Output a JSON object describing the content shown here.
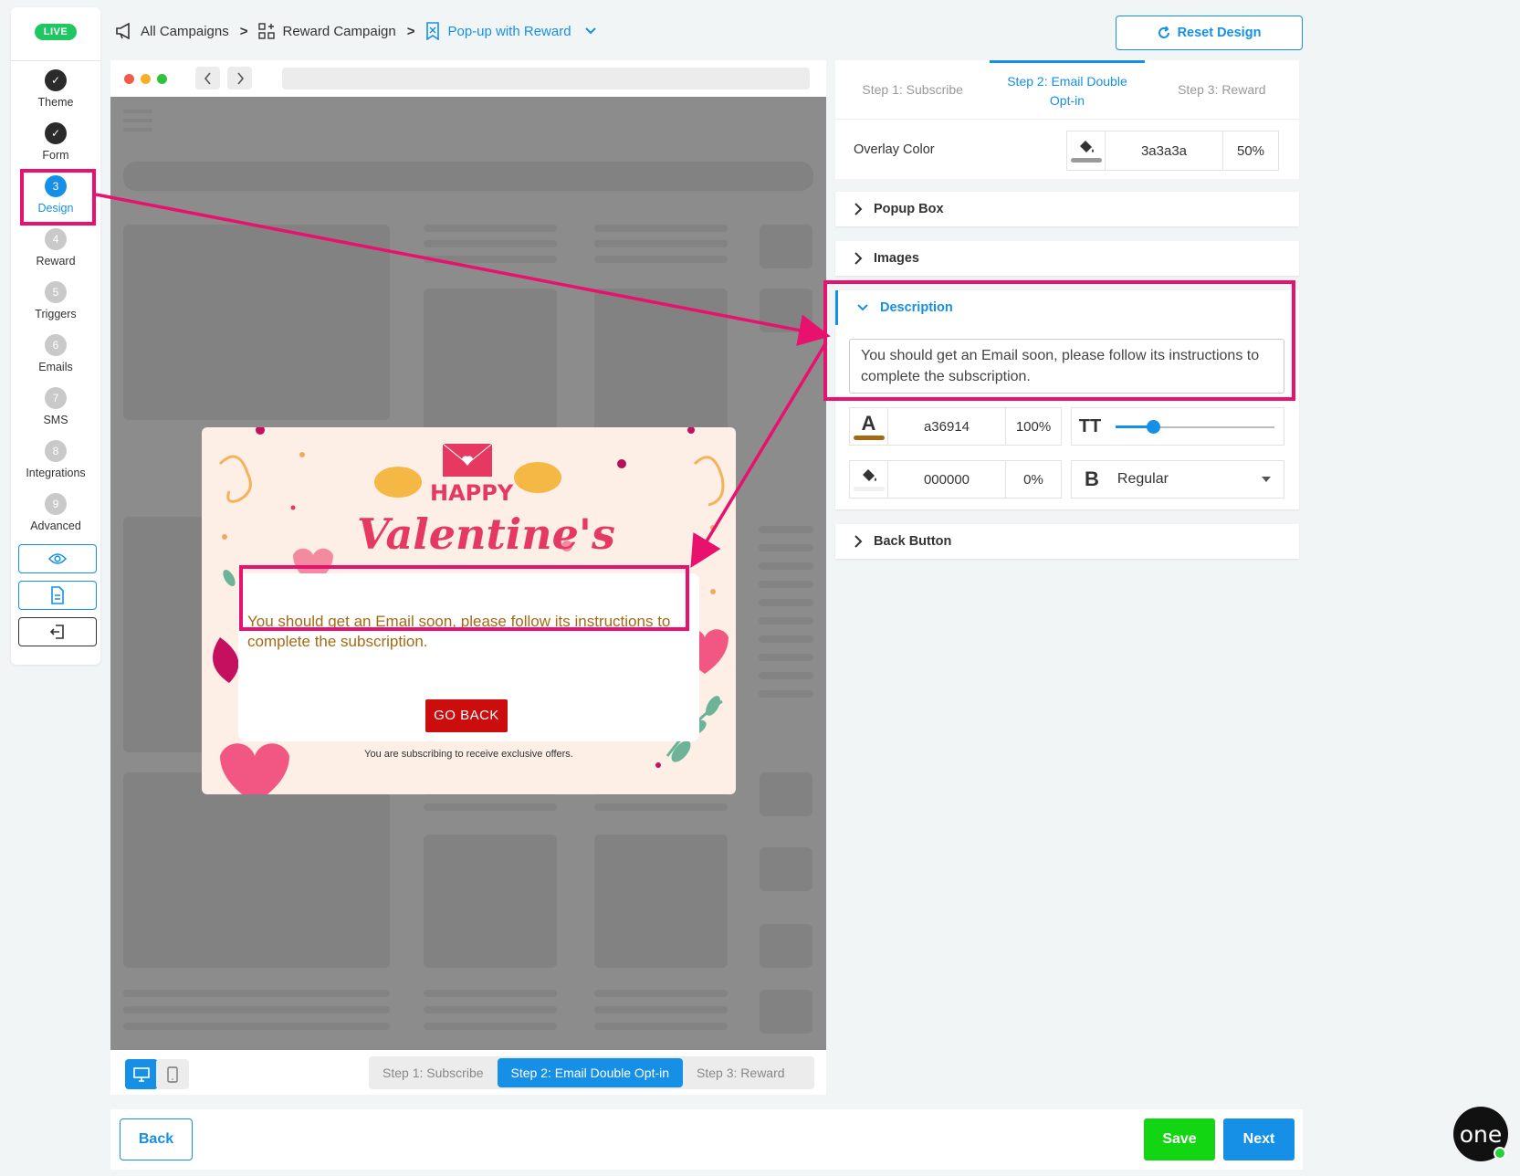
{
  "sidebar": {
    "live_badge": "LIVE",
    "steps": [
      {
        "number": "",
        "label": "Theme",
        "state": "done"
      },
      {
        "number": "",
        "label": "Form",
        "state": "done"
      },
      {
        "number": "3",
        "label": "Design",
        "state": "active"
      },
      {
        "number": "4",
        "label": "Reward",
        "state": "todo"
      },
      {
        "number": "5",
        "label": "Triggers",
        "state": "todo"
      },
      {
        "number": "6",
        "label": "Emails",
        "state": "todo"
      },
      {
        "number": "7",
        "label": "SMS",
        "state": "todo"
      },
      {
        "number": "8",
        "label": "Integrations",
        "state": "todo"
      },
      {
        "number": "9",
        "label": "Advanced",
        "state": "todo"
      }
    ],
    "buttons": [
      "eye-icon",
      "document-icon",
      "exit-icon"
    ]
  },
  "breadcrumb": {
    "items": [
      "All Campaigns",
      "Reward Campaign",
      "Pop-up with Reward"
    ],
    "separator": ">"
  },
  "reset_button": "Reset Design",
  "preview": {
    "popup": {
      "happy": "HAPPY",
      "headline": "Valentine's",
      "description": "You should get an Email soon, please follow its instructions to complete the subscription.",
      "go_back": "GO BACK",
      "footer": "You are subscribing to receive exclusive offers."
    },
    "step_switch": [
      "Step 1: Subscribe",
      "Step 2: Email Double Opt-in",
      "Step 3: Reward"
    ],
    "active_step": 1
  },
  "panel": {
    "tabs": [
      "Step 1: Subscribe",
      "Step 2: Email Double Opt-in",
      "Step 3: Reward"
    ],
    "overlay": {
      "label": "Overlay Color",
      "color": "3a3a3a",
      "opacity": "50%"
    },
    "sections": {
      "popup_box": "Popup Box",
      "images": "Images",
      "description": "Description",
      "back_button": "Back Button"
    },
    "description_text": "You should get an Email soon, please follow its instructions to complete the subscription.",
    "text_color": {
      "glyph": "A",
      "hex": "a36914",
      "opacity": "100%"
    },
    "bg_color": {
      "hex": "000000",
      "opacity": "0%"
    },
    "font_size_glyph": "TT",
    "font_size_level": 0.25,
    "weight": {
      "glyph": "B",
      "value": "Regular"
    }
  },
  "footer": {
    "back": "Back",
    "save": "Save",
    "next": "Next"
  },
  "logo": "one",
  "colors": {
    "accent": "#1590e6",
    "highlight": "#e8116e",
    "text_color": "#a36914",
    "save": "#13d613"
  }
}
